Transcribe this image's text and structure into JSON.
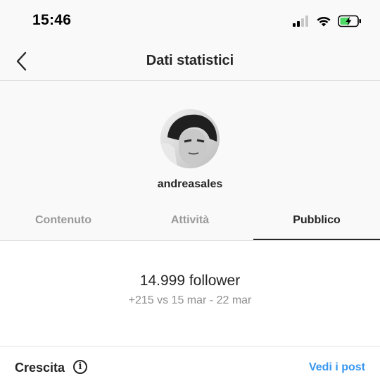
{
  "status_bar": {
    "time": "15:46",
    "signal_icon": "cellular-signal-icon",
    "wifi_icon": "wifi-icon",
    "battery_icon": "battery-charging-icon",
    "battery_color": "#4cd964"
  },
  "header": {
    "back_icon": "chevron-left-icon",
    "title": "Dati statistici"
  },
  "profile": {
    "username": "andreasales"
  },
  "tabs": [
    {
      "label": "Contenuto",
      "active": false
    },
    {
      "label": "Attività",
      "active": false
    },
    {
      "label": "Pubblico",
      "active": true
    }
  ],
  "audience": {
    "followers": "14.999 follower",
    "delta": "+215 vs 15 mar - 22 mar"
  },
  "growth_section": {
    "title": "Crescita",
    "info_icon": "info-circle-icon",
    "link": "Vedi i post",
    "link_color": "#3897f0"
  }
}
